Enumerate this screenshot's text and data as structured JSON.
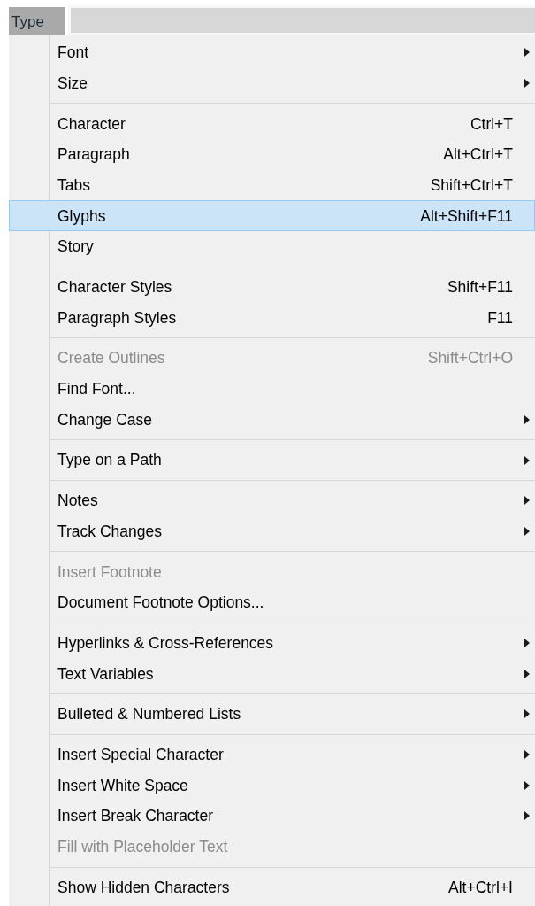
{
  "menubar": {
    "title": "Type",
    "selected": true
  },
  "menu": {
    "groups": [
      {
        "items": [
          {
            "label": "Font",
            "submenu": true,
            "disabled": false,
            "selected": false
          },
          {
            "label": "Size",
            "submenu": true,
            "disabled": false,
            "selected": false
          }
        ]
      },
      {
        "items": [
          {
            "label": "Character",
            "shortcut": "Ctrl+T",
            "submenu": false,
            "disabled": false,
            "selected": false
          },
          {
            "label": "Paragraph",
            "shortcut": "Alt+Ctrl+T",
            "submenu": false,
            "disabled": false,
            "selected": false
          },
          {
            "label": "Tabs",
            "shortcut": "Shift+Ctrl+T",
            "submenu": false,
            "disabled": false,
            "selected": false
          },
          {
            "label": "Glyphs",
            "shortcut": "Alt+Shift+F11",
            "submenu": false,
            "disabled": false,
            "selected": true
          },
          {
            "label": "Story",
            "submenu": false,
            "disabled": false,
            "selected": false
          }
        ]
      },
      {
        "items": [
          {
            "label": "Character Styles",
            "shortcut": "Shift+F11",
            "submenu": false,
            "disabled": false,
            "selected": false
          },
          {
            "label": "Paragraph Styles",
            "shortcut": "F11",
            "submenu": false,
            "disabled": false,
            "selected": false
          }
        ]
      },
      {
        "items": [
          {
            "label": "Create Outlines",
            "shortcut": "Shift+Ctrl+O",
            "submenu": false,
            "disabled": true,
            "selected": false
          },
          {
            "label": "Find Font...",
            "submenu": false,
            "disabled": false,
            "selected": false
          },
          {
            "label": "Change Case",
            "submenu": true,
            "disabled": false,
            "selected": false
          }
        ]
      },
      {
        "items": [
          {
            "label": "Type on a Path",
            "submenu": true,
            "disabled": false,
            "selected": false
          }
        ]
      },
      {
        "items": [
          {
            "label": "Notes",
            "submenu": true,
            "disabled": false,
            "selected": false
          },
          {
            "label": "Track Changes",
            "submenu": true,
            "disabled": false,
            "selected": false
          }
        ]
      },
      {
        "items": [
          {
            "label": "Insert Footnote",
            "submenu": false,
            "disabled": true,
            "selected": false
          },
          {
            "label": "Document Footnote Options...",
            "submenu": false,
            "disabled": false,
            "selected": false
          }
        ]
      },
      {
        "items": [
          {
            "label": "Hyperlinks & Cross-References",
            "submenu": true,
            "disabled": false,
            "selected": false
          },
          {
            "label": "Text Variables",
            "submenu": true,
            "disabled": false,
            "selected": false
          }
        ]
      },
      {
        "items": [
          {
            "label": "Bulleted & Numbered Lists",
            "submenu": true,
            "disabled": false,
            "selected": false
          }
        ]
      },
      {
        "items": [
          {
            "label": "Insert Special Character",
            "submenu": true,
            "disabled": false,
            "selected": false
          },
          {
            "label": "Insert White Space",
            "submenu": true,
            "disabled": false,
            "selected": false
          },
          {
            "label": "Insert Break Character",
            "submenu": true,
            "disabled": false,
            "selected": false
          },
          {
            "label": "Fill with Placeholder Text",
            "submenu": false,
            "disabled": true,
            "selected": false
          }
        ]
      },
      {
        "items": [
          {
            "label": "Show Hidden Characters",
            "shortcut": "Alt+Ctrl+I",
            "submenu": false,
            "disabled": false,
            "selected": false
          }
        ]
      }
    ]
  }
}
